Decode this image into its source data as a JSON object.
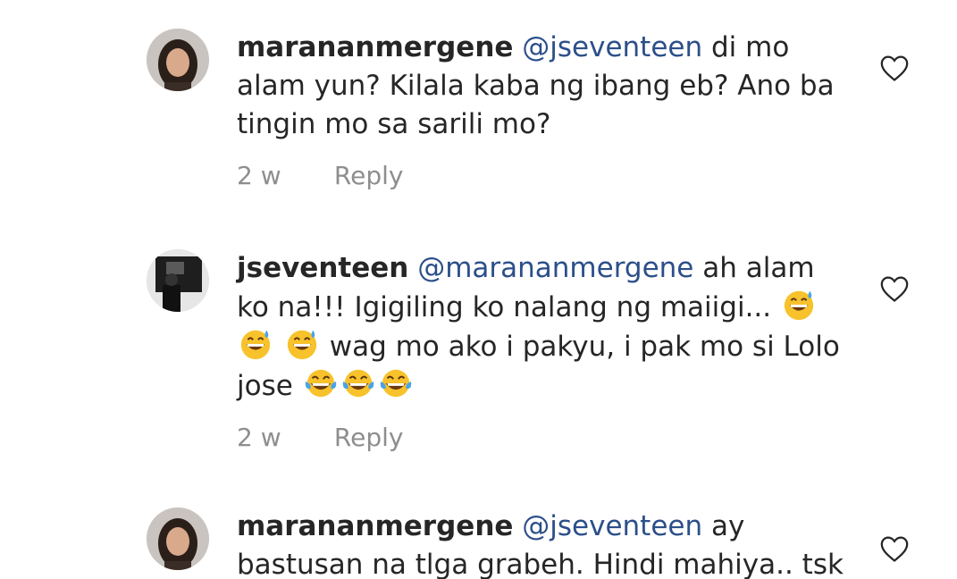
{
  "comments": [
    {
      "username": "marananmergene",
      "mention": "@jseventeen",
      "text": " di mo alam yun? Kilala kaba ng ibang eb? Ano ba tingin mo sa sarili mo?",
      "time": "2 w",
      "reply_label": "Reply",
      "avatar": "profile-photo-woman"
    },
    {
      "username": "jseventeen",
      "mention": "@marananmergene",
      "text_part1": " ah alam ko na!!! Igigiling ko nalang ng maiigi... ",
      "text_part2": " wag mo ako i pakyu, i pak mo si Lolo jose ",
      "time": "2 w",
      "reply_label": "Reply",
      "avatar": "profile-photo-dark"
    },
    {
      "username": "marananmergene",
      "mention": "@jseventeen",
      "text": " ay bastusan na tlga grabeh. Hindi mahiya.. tsk",
      "avatar": "profile-photo-woman"
    }
  ],
  "icons": {
    "like": "heart-outline-icon",
    "emoji_sweat": "grinning-sweat-emoji",
    "emoji_laugh": "tears-of-joy-emoji"
  }
}
